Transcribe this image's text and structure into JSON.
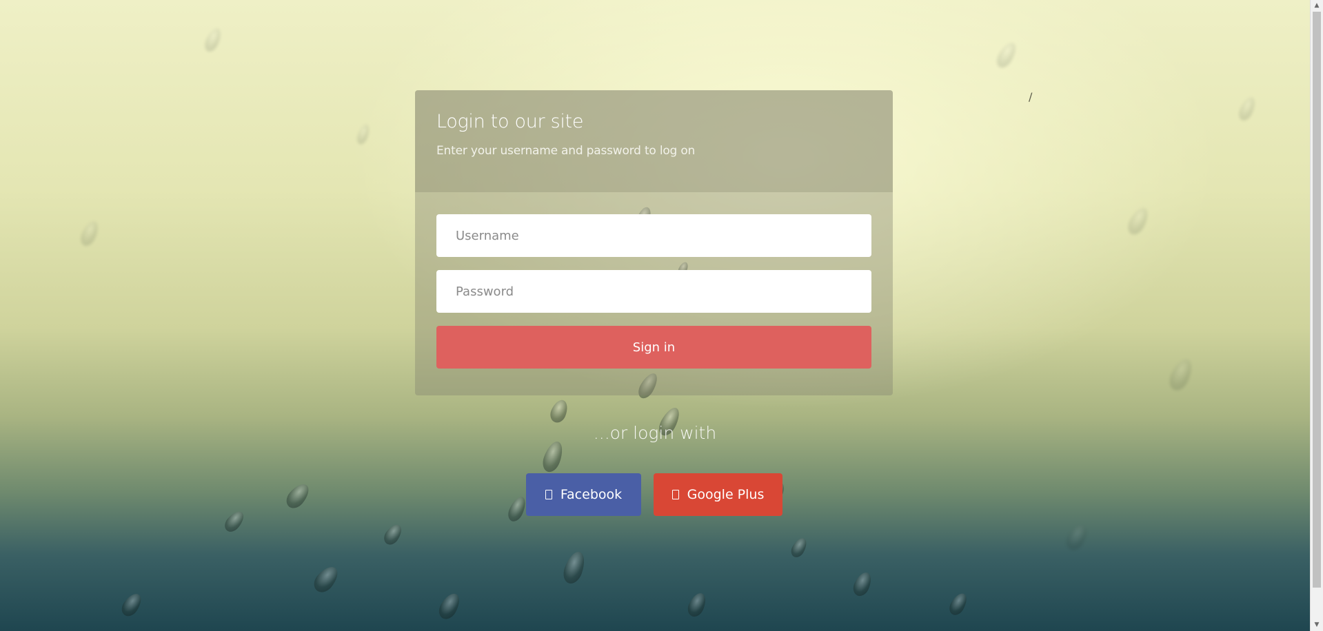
{
  "login": {
    "title": "Login to our site",
    "subtitle": "Enter your username and password to log on",
    "username_placeholder": "Username",
    "password_placeholder": "Password",
    "signin_label": "Sign in"
  },
  "social": {
    "or_text": "...or login with",
    "facebook_label": "Facebook",
    "facebook_icon": "facebook-icon",
    "googleplus_label": "Google Plus",
    "googleplus_icon": "google-plus-icon"
  },
  "stray_text": "/",
  "colors": {
    "signin": "#de615e",
    "facebook": "#4a5fa6",
    "googleplus": "#d94735"
  }
}
